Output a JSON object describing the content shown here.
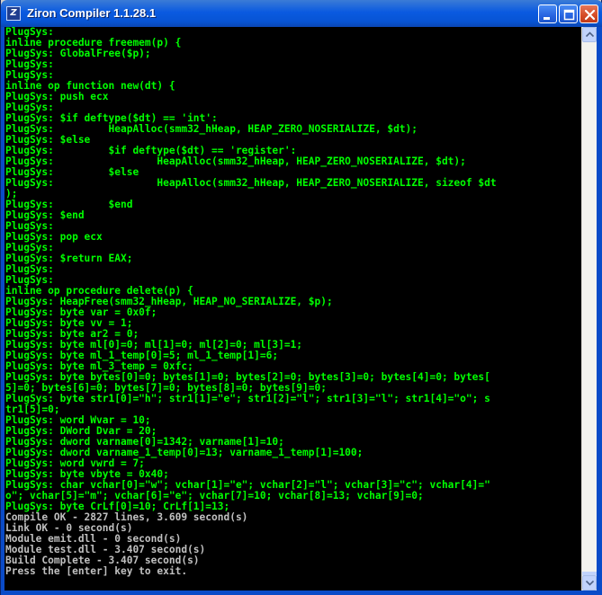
{
  "window": {
    "title": "Ziron Compiler 1.1.28.1",
    "icon": "Z",
    "buttons": [
      "minimize-icon",
      "maximize-icon",
      "close-icon"
    ]
  },
  "colors": {
    "plugsys_text": "#00ff00",
    "system_text": "#c0c0c0",
    "background": "#000000"
  },
  "console": {
    "lines": [
      {
        "text": "PlugSys:",
        "kind": "plug"
      },
      {
        "text": "inline procedure freemem(p) {",
        "kind": "plug"
      },
      {
        "text": "PlugSys: GlobalFree($p);",
        "kind": "plug"
      },
      {
        "text": "PlugSys:",
        "kind": "plug"
      },
      {
        "text": "PlugSys:",
        "kind": "plug"
      },
      {
        "text": "inline op function new(dt) {",
        "kind": "plug"
      },
      {
        "text": "PlugSys: push ecx",
        "kind": "plug"
      },
      {
        "text": "PlugSys:",
        "kind": "plug"
      },
      {
        "text": "PlugSys: $if deftype($dt) == 'int':",
        "kind": "plug"
      },
      {
        "text": "PlugSys:         HeapAlloc(smm32_hHeap, HEAP_ZERO_NOSERIALIZE, $dt);",
        "kind": "plug"
      },
      {
        "text": "PlugSys: $else",
        "kind": "plug"
      },
      {
        "text": "PlugSys:         $if deftype($dt) == 'register':",
        "kind": "plug"
      },
      {
        "text": "PlugSys:                 HeapAlloc(smm32_hHeap, HEAP_ZERO_NOSERIALIZE, $dt);",
        "kind": "plug"
      },
      {
        "text": "PlugSys:         $else",
        "kind": "plug"
      },
      {
        "text": "PlugSys:                 HeapAlloc(smm32_hHeap, HEAP_ZERO_NOSERIALIZE, sizeof $dt",
        "kind": "plug"
      },
      {
        "text": ");",
        "kind": "plug"
      },
      {
        "text": "PlugSys:         $end",
        "kind": "plug"
      },
      {
        "text": "PlugSys: $end",
        "kind": "plug"
      },
      {
        "text": "PlugSys:",
        "kind": "plug"
      },
      {
        "text": "PlugSys: pop ecx",
        "kind": "plug"
      },
      {
        "text": "PlugSys:",
        "kind": "plug"
      },
      {
        "text": "PlugSys: $return EAX;",
        "kind": "plug"
      },
      {
        "text": "PlugSys:",
        "kind": "plug"
      },
      {
        "text": "PlugSys:",
        "kind": "plug"
      },
      {
        "text": "inline op procedure delete(p) {",
        "kind": "plug"
      },
      {
        "text": "PlugSys: HeapFree(smm32_hHeap, HEAP_NO_SERIALIZE, $p);",
        "kind": "plug"
      },
      {
        "text": "PlugSys: byte var = 0x0f;",
        "kind": "plug"
      },
      {
        "text": "PlugSys: byte vv = 1;",
        "kind": "plug"
      },
      {
        "text": "PlugSys: byte ar2 = 0;",
        "kind": "plug"
      },
      {
        "text": "PlugSys: byte ml[0]=0; ml[1]=0; ml[2]=0; ml[3]=1;",
        "kind": "plug"
      },
      {
        "text": "PlugSys: byte ml_1_temp[0]=5; ml_1_temp[1]=6;",
        "kind": "plug"
      },
      {
        "text": "PlugSys: byte ml_3_temp = 0xfc;",
        "kind": "plug"
      },
      {
        "text": "PlugSys: byte bytes[0]=0; bytes[1]=0; bytes[2]=0; bytes[3]=0; bytes[4]=0; bytes[",
        "kind": "plug"
      },
      {
        "text": "5]=0; bytes[6]=0; bytes[7]=0; bytes[8]=0; bytes[9]=0;",
        "kind": "plug"
      },
      {
        "text": "PlugSys: byte str1[0]=\"h\"; str1[1]=\"e\"; str1[2]=\"l\"; str1[3]=\"l\"; str1[4]=\"o\"; s",
        "kind": "plug"
      },
      {
        "text": "tr1[5]=0;",
        "kind": "plug"
      },
      {
        "text": "PlugSys: word Wvar = 10;",
        "kind": "plug"
      },
      {
        "text": "PlugSys: DWord Dvar = 20;",
        "kind": "plug"
      },
      {
        "text": "PlugSys: dword varname[0]=1342; varname[1]=10;",
        "kind": "plug"
      },
      {
        "text": "PlugSys: dword varname_1_temp[0]=13; varname_1_temp[1]=100;",
        "kind": "plug"
      },
      {
        "text": "PlugSys: word vwrd = 7;",
        "kind": "plug"
      },
      {
        "text": "PlugSys: byte vbyte = 0x40;",
        "kind": "plug"
      },
      {
        "text": "PlugSys: char vchar[0]=\"w\"; vchar[1]=\"e\"; vchar[2]=\"l\"; vchar[3]=\"c\"; vchar[4]=\"",
        "kind": "plug"
      },
      {
        "text": "o\"; vchar[5]=\"m\"; vchar[6]=\"e\"; vchar[7]=10; vchar[8]=13; vchar[9]=0;",
        "kind": "plug"
      },
      {
        "text": "PlugSys: byte CrLf[0]=10; CrLf[1]=13;",
        "kind": "plug"
      },
      {
        "text": "Compile OK - 2827 lines, 3.609 second(s)",
        "kind": "sys"
      },
      {
        "text": "Link OK - 0 second(s)",
        "kind": "sys"
      },
      {
        "text": "Module emit.dll - 0 second(s)",
        "kind": "sys"
      },
      {
        "text": "Module test.dll - 3.407 second(s)",
        "kind": "sys"
      },
      {
        "text": "Build Complete - 3.407 second(s)",
        "kind": "sys"
      },
      {
        "text": "Press the [enter] key to exit.",
        "kind": "sys"
      }
    ]
  },
  "scrollbar": {
    "position": 0.99
  }
}
